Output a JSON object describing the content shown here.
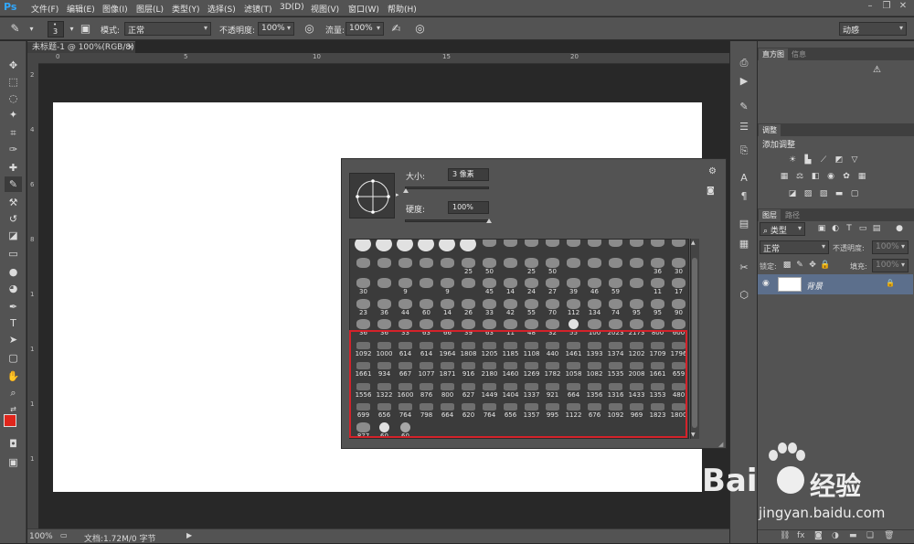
{
  "app": {
    "logo": "Ps"
  },
  "menu": [
    "文件(F)",
    "编辑(E)",
    "图像(I)",
    "图层(L)",
    "类型(Y)",
    "选择(S)",
    "滤镜(T)",
    "3D(D)",
    "视图(V)",
    "窗口(W)",
    "帮助(H)"
  ],
  "options": {
    "brush_size": "3",
    "mode_label": "模式:",
    "mode_value": "正常",
    "opacity_label": "不透明度:",
    "opacity_value": "100%",
    "flow_label": "流量:",
    "flow_value": "100%",
    "workspace": "动感"
  },
  "document": {
    "tab_title": "未标题-1 @ 100%(RGB/8)",
    "close": "×"
  },
  "ruler_top": [
    "0",
    "5",
    "10",
    "15",
    "20"
  ],
  "ruler_left": [
    "2",
    "4",
    "6",
    "8",
    "1",
    "1",
    "1",
    "1"
  ],
  "statusbar": {
    "zoom": "100%",
    "doc_info": "文档:1.72M/0 字节"
  },
  "brush_panel": {
    "size_label": "大小:",
    "size_value": "3 像素",
    "size_fraction": 0.01,
    "hardness_label": "硬度:",
    "hardness_value": "100%",
    "hardness_fraction": 1.0,
    "rows": [
      [
        "",
        "",
        "",
        "",
        "",
        "",
        "",
        "",
        "",
        "",
        "",
        "",
        "",
        "",
        "",
        ""
      ],
      [
        "",
        "",
        "",
        "",
        "",
        "25",
        "50",
        "",
        "25",
        "50",
        "",
        "",
        "",
        "",
        "36",
        "30"
      ],
      [
        "30",
        "",
        "9",
        "",
        "9",
        "",
        "45",
        "14",
        "24",
        "27",
        "39",
        "46",
        "59",
        "",
        "11",
        "17"
      ],
      [
        "23",
        "36",
        "44",
        "60",
        "14",
        "26",
        "33",
        "42",
        "55",
        "70",
        "112",
        "134",
        "74",
        "95",
        "95",
        "90"
      ],
      [
        "36",
        "36",
        "33",
        "63",
        "66",
        "39",
        "63",
        "11",
        "48",
        "32",
        "55",
        "100",
        "2023",
        "2173",
        "800",
        "600"
      ],
      [
        "1092",
        "1000",
        "614",
        "614",
        "1964",
        "1808",
        "1205",
        "1185",
        "1108",
        "440",
        "1461",
        "1393",
        "1374",
        "1202",
        "1709",
        "1796"
      ],
      [
        "1661",
        "934",
        "667",
        "1077",
        "1871",
        "916",
        "2180",
        "1460",
        "1269",
        "1782",
        "1058",
        "1082",
        "1535",
        "2008",
        "1661",
        "659"
      ],
      [
        "1556",
        "1322",
        "1600",
        "876",
        "800",
        "627",
        "1449",
        "1404",
        "1337",
        "921",
        "664",
        "1356",
        "1316",
        "1433",
        "1353",
        "480"
      ],
      [
        "699",
        "656",
        "764",
        "798",
        "664",
        "620",
        "764",
        "656",
        "1357",
        "995",
        "1122",
        "676",
        "1092",
        "969",
        "1823",
        "1800"
      ],
      [
        "877",
        "60",
        "60"
      ]
    ]
  },
  "panels": {
    "histogram_tabs": [
      "直方图",
      "信息"
    ],
    "adjustments_tab": "调整",
    "adjustments_title": "添加调整",
    "layers_tabs": [
      "图层",
      "路径"
    ],
    "kind_filter": "类型",
    "blend_mode": "正常",
    "opacity_label": "不透明度:",
    "opacity_value": "100%",
    "lock_label": "锁定:",
    "fill_label": "填充:",
    "fill_value": "100%",
    "layer_name": "背景"
  },
  "watermark": {
    "brand": "Bai",
    "brand_cn": "经验",
    "url": "jingyan.baidu.com"
  },
  "colors": {
    "foreground": "#e0261c",
    "background": "#ffffff",
    "highlight": "#d4222a",
    "accent": "#31a8ff"
  }
}
